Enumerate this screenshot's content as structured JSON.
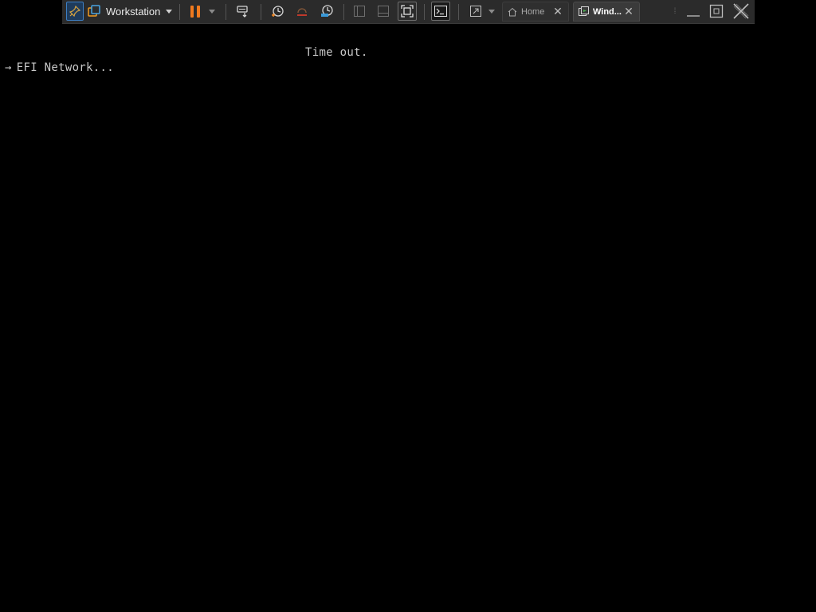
{
  "toolbar": {
    "vm_menu_label": "Workstation",
    "icons": {
      "pin": "pin-icon",
      "vm": "workstation-icon",
      "pause": "pause-icon",
      "send_keys": "send-ctrl-alt-del-icon",
      "snapshot": "take-snapshot-icon",
      "revert": "revert-snapshot-icon",
      "manage": "snapshot-manager-icon",
      "view1": "library-view-icon",
      "view2": "thumbnail-view-icon",
      "fullscreen": "fullscreen-icon",
      "console": "console-view-icon",
      "stretch": "stretch-guest-icon",
      "minimize": "minimize-icon",
      "restore": "restore-icon",
      "close": "close-icon"
    },
    "tabs": [
      {
        "label": "Home",
        "icon": "home-icon",
        "active": false
      },
      {
        "label": "Wind...",
        "icon": "vm-tab-icon",
        "active": true
      }
    ],
    "colors": {
      "pause_accent": "#f07a1e",
      "pin_highlight": "#3d7fc4"
    }
  },
  "console": {
    "timeout_message": "Time out.",
    "boot_arrow": "→",
    "boot_entry": "EFI Network..."
  }
}
